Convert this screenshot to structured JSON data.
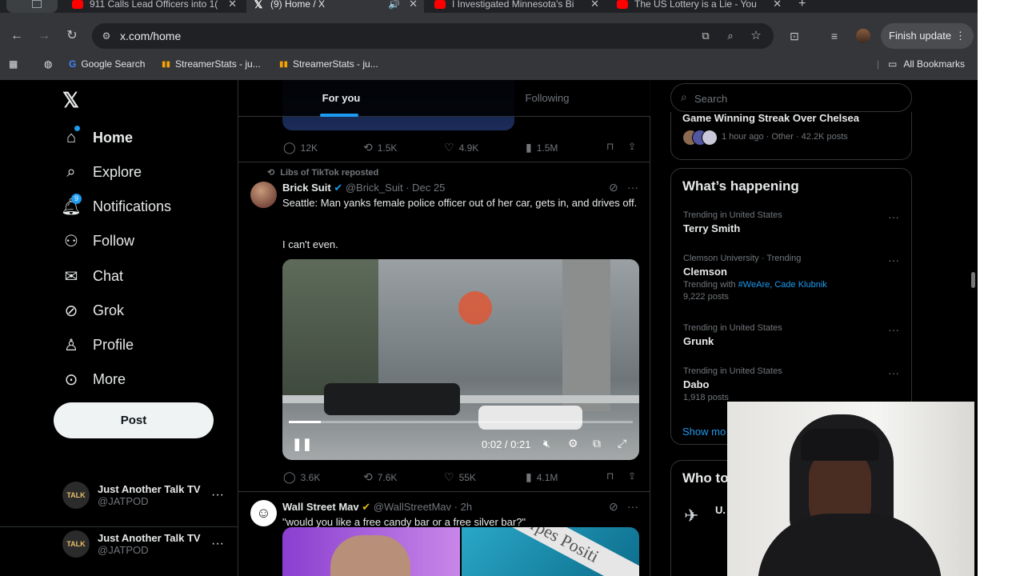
{
  "browser": {
    "tabs": [
      {
        "title": "911 Calls Lead Officers into 1("
      },
      {
        "title": "(9) Home / X"
      },
      {
        "title": "I Investigated Minnesota's Bi"
      },
      {
        "title": "The US Lottery is a Lie - You"
      }
    ],
    "new_tab": "+",
    "url": "x.com/home",
    "finish_update": "Finish update",
    "bookmarks": [
      "Google Search",
      "StreamerStats - ju...",
      "StreamerStats - ju..."
    ],
    "all_bookmarks": "All Bookmarks"
  },
  "nav": {
    "items": [
      {
        "label": "Home",
        "icon": "home-icon"
      },
      {
        "label": "Explore",
        "icon": "search-icon"
      },
      {
        "label": "Notifications",
        "icon": "bell-icon"
      },
      {
        "label": "Follow",
        "icon": "add-person-icon"
      },
      {
        "label": "Chat",
        "icon": "envelope-icon"
      },
      {
        "label": "Grok",
        "icon": "grok-icon"
      },
      {
        "label": "Profile",
        "icon": "person-icon"
      },
      {
        "label": "More",
        "icon": "more-circle-icon"
      }
    ],
    "notification_badge": "9",
    "post_label": "Post",
    "account": {
      "name": "Just Another Talk TV",
      "handle": "@JATPOD",
      "avatar_text": "TALK"
    }
  },
  "timeline": {
    "tabs": [
      "For you",
      "Following"
    ],
    "prev_post_stats": {
      "replies": "12K",
      "reposts": "1.5K",
      "likes": "4.9K",
      "views": "1.5M"
    },
    "post1": {
      "repost_label": "Libs of TikTok reposted",
      "name": "Brick Suit",
      "handle": "@Brick_Suit",
      "date": "Dec 25",
      "text1": "Seattle: Man yanks female police officer out of her car, gets in, and drives off.",
      "text2": "I can't even.",
      "video_time": "0:02 / 0:21",
      "stats": {
        "replies": "3.6K",
        "reposts": "7.6K",
        "likes": "55K",
        "views": "4.1M"
      }
    },
    "post2": {
      "name": "Wall Street Mav",
      "handle": "@WallStreetMav",
      "date": "2h",
      "text": "\"would you like a free candy bar or a free silver bar?\"",
      "image_text": "rpes Positi"
    }
  },
  "sidebar": {
    "search_placeholder": "Search",
    "top_item": {
      "title": "Game Winning Streak Over Chelsea",
      "meta": "1 hour ago · Other · 42.2K posts"
    },
    "whats_happening": "What’s happening",
    "trends": [
      {
        "context": "Trending in United States",
        "title": "Terry Smith"
      },
      {
        "context": "Clemson University · Trending",
        "title": "Clemson",
        "with_label": "Trending with",
        "with_tags": "#WeAre, Cade Klubnik",
        "posts": "9,222 posts"
      },
      {
        "context": "Trending in United States",
        "title": "Grunk"
      },
      {
        "context": "Trending in United States",
        "title": "Dabo",
        "posts": "1,918 posts"
      }
    ],
    "show_more": "Show mo",
    "who_to_follow": "Who to",
    "who_first": "U."
  },
  "colors": {
    "accent": "#1d9bf0",
    "verified_gold": "#e2b719",
    "background": "#000000"
  }
}
